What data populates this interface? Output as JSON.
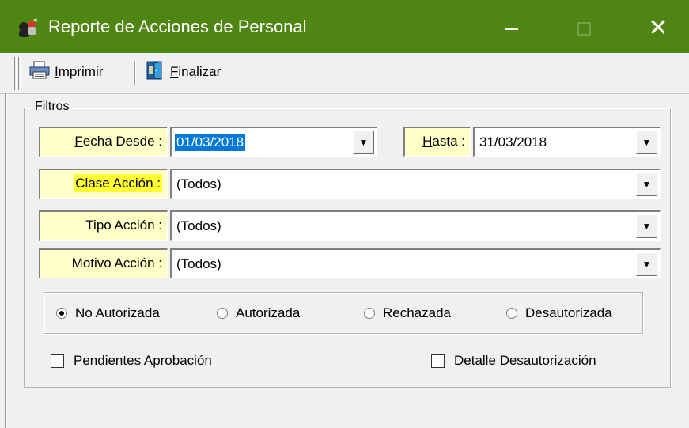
{
  "window": {
    "title": "Reporte de Acciones de Personal",
    "titlebar_color": "#4f8512",
    "close_glyph": "✕"
  },
  "toolbar": {
    "print_label": "Imprimir",
    "print_underline": "I",
    "finish_label": "Finalizar",
    "finish_underline": "F"
  },
  "filters": {
    "legend": "Filtros",
    "fecha_desde": {
      "label": "Fecha Desde :",
      "value": "01/03/2018"
    },
    "hasta": {
      "label": "Hasta :",
      "value": "31/03/2018"
    },
    "clase_accion": {
      "label": "Clase Acción :",
      "value": "(Todos)"
    },
    "tipo_accion": {
      "label": "Tipo Acción :",
      "value": "(Todos)"
    },
    "motivo_accion": {
      "label": "Motivo Acción :",
      "value": "(Todos)"
    },
    "status_options": [
      {
        "label": "No Autorizada",
        "selected": true
      },
      {
        "label": "Autorizada",
        "selected": false
      },
      {
        "label": "Rechazada",
        "selected": false
      },
      {
        "label": "Desautorizada",
        "selected": false
      }
    ],
    "pendientes_aprobacion": {
      "label": "Pendientes Aprobación",
      "checked": false
    },
    "detalle_desautorizacion": {
      "label": "Detalle Desautorización",
      "checked": false
    }
  },
  "colors": {
    "label_bg": "#ffffc8",
    "highlight": "#ffff33",
    "selection": "#0078d7"
  }
}
